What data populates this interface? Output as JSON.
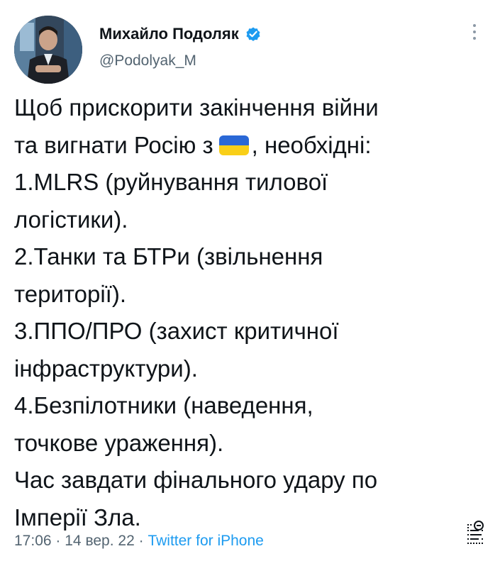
{
  "author": {
    "display_name": "Михайло Подоляк",
    "handle": "@Podolyak_M",
    "verified": true
  },
  "tweet": {
    "lines": [
      {
        "text": "Щоб прискорити закінчення війни"
      },
      {
        "before": "та вигнати Росію з",
        "emoji": "ukraine-flag",
        "after": ", необхідні:"
      },
      {
        "text": "1.MLRS (руйнування тилової"
      },
      {
        "text": "логістики)."
      },
      {
        "text": "2.Танки та БТРи (звільнення"
      },
      {
        "text": "території)."
      },
      {
        "text": "3.ППО/ПРО (захист критичної"
      },
      {
        "text": "інфраструктури)."
      },
      {
        "text": "4.Безпілотники (наведення,"
      },
      {
        "text": "точкове ураження)."
      },
      {
        "text": "Час завдати фінального удару по"
      },
      {
        "text": "Імперії Зла."
      }
    ]
  },
  "meta": {
    "time": "17:06",
    "date": "14 вер. 22",
    "separator": "·",
    "source": "Twitter for iPhone"
  },
  "icons": {
    "more": "more-vertical-icon",
    "verified": "verified-badge-icon",
    "translate": "translate-icon"
  },
  "colors": {
    "text": "#0f1419",
    "secondary": "#536471",
    "link": "#1d9bf0",
    "flag_blue": "#2a68d6",
    "flag_yellow": "#f9cf18"
  }
}
